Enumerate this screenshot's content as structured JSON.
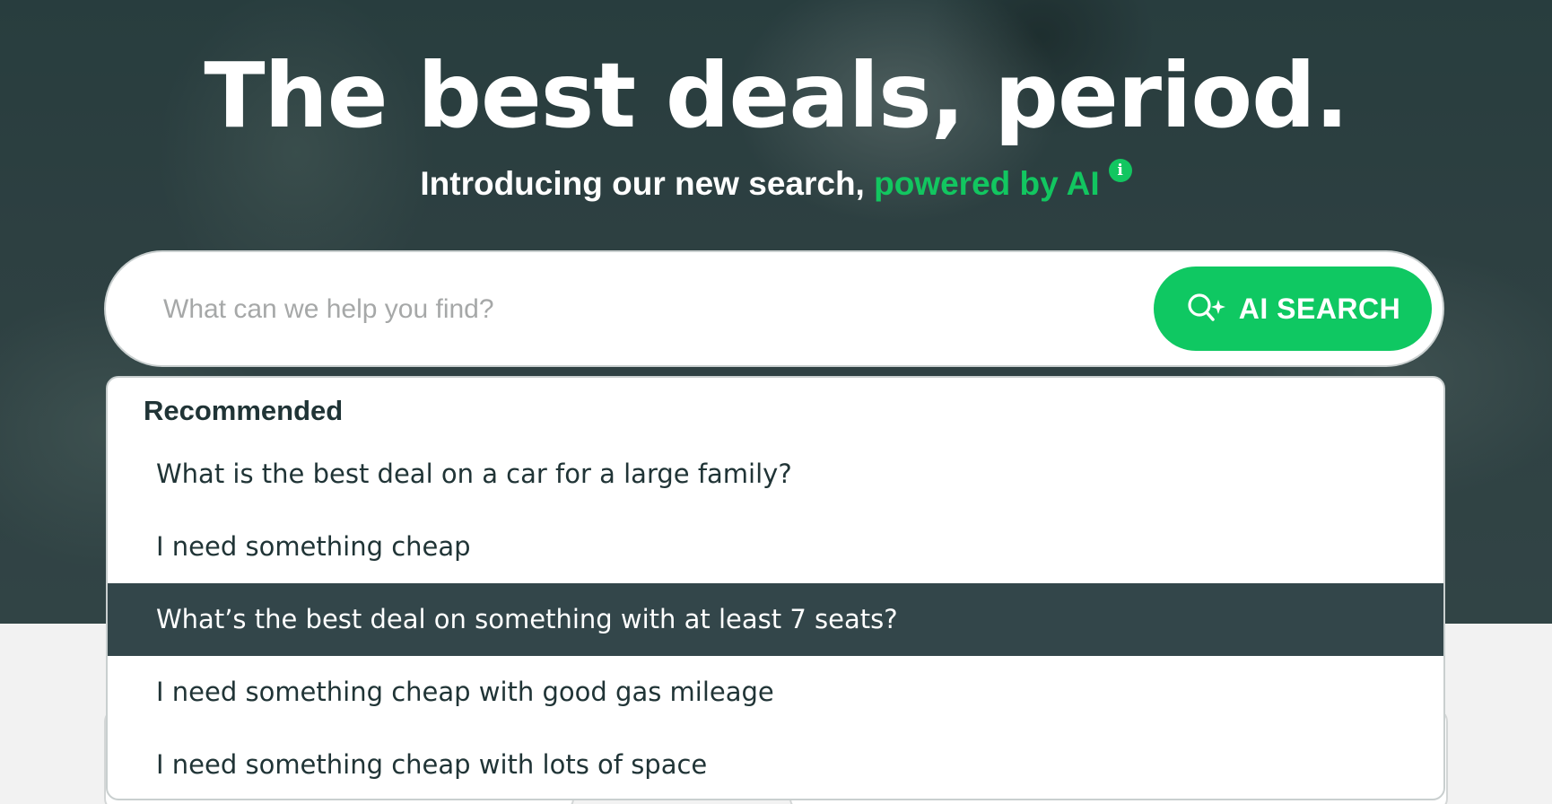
{
  "hero": {
    "headline": "The best deals, period.",
    "subhead_text": "Introducing our new search, ",
    "subhead_accent": "powered by AI",
    "info_icon_glyph": "i"
  },
  "search": {
    "placeholder": "What can we help you find?",
    "value": "",
    "button_label": "AI SEARCH",
    "button_icon": "ai-search-sparkle-icon"
  },
  "dropdown": {
    "heading": "Recommended",
    "suggestions": [
      "What is the best deal on a car for a large family?",
      "I need something cheap",
      "What’s the best deal on something with at least 7 seats?",
      "I need something cheap with good gas mileage",
      "I need something cheap with lots of space"
    ],
    "active_index": 2
  },
  "colors": {
    "accent": "#0fc862",
    "hero_bg": "#37494b",
    "active_row": "#33464a",
    "text_dark": "#203436"
  }
}
